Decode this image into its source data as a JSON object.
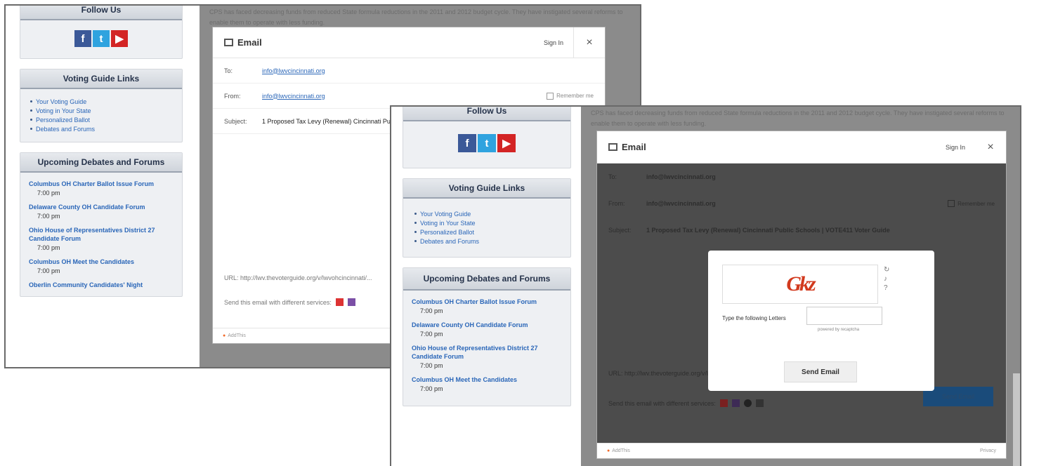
{
  "sidebar": {
    "follow_title": "Follow Us",
    "social": [
      "facebook-icon",
      "twitter-icon",
      "youtube-icon"
    ],
    "guide_title": "Voting Guide Links",
    "guide_links": [
      "Your Voting Guide",
      "Voting in Your State",
      "Personalized Ballot",
      "Debates and Forums"
    ],
    "events_title": "Upcoming Debates and Forums",
    "events": [
      {
        "name": "Columbus OH Charter Ballot Issue Forum",
        "time": "7:00 pm"
      },
      {
        "name": "Delaware County OH Candidate Forum",
        "time": "7:00 pm"
      },
      {
        "name": "Ohio House of Representatives District 27 Candidate Forum",
        "time": "7:00 pm"
      },
      {
        "name": "Columbus OH Meet the Candidates",
        "time": "7:00 pm"
      },
      {
        "name": "Oberlin Community Candidates' Night",
        "time": ""
      }
    ]
  },
  "background_text": "CPS has faced decreasing funds from reduced State formula reductions in the 2011 and 2012 budget cycle. They have instigated several reforms to enable them to operate with less funding.",
  "modal": {
    "title": "Email",
    "sign_in": "Sign In",
    "close": "×",
    "to_label": "To:",
    "to_value": "info@lwvcincinnati.org",
    "from_label": "From:",
    "from_value": "info@lwvcincinnati.org",
    "remember": "Remember me",
    "subject_label": "Subject:",
    "subject_value": "1 Proposed Tax Levy (Renewal) Cincinnati Public Schools | VOTE411 Voter Guide",
    "url_label": "URL:",
    "url_value": "http://lwv.thevoterguide.org/v/lwvohcincinnati/...",
    "services_label": "Send this email with different services:",
    "send_button": "Send Email",
    "addthis": "AddThis",
    "privacy": "Privacy"
  },
  "captcha": {
    "image_text": "Gkz",
    "instruction": "Type the following Letters",
    "powered": "powered by recaptcha",
    "submit": "Send Email"
  }
}
